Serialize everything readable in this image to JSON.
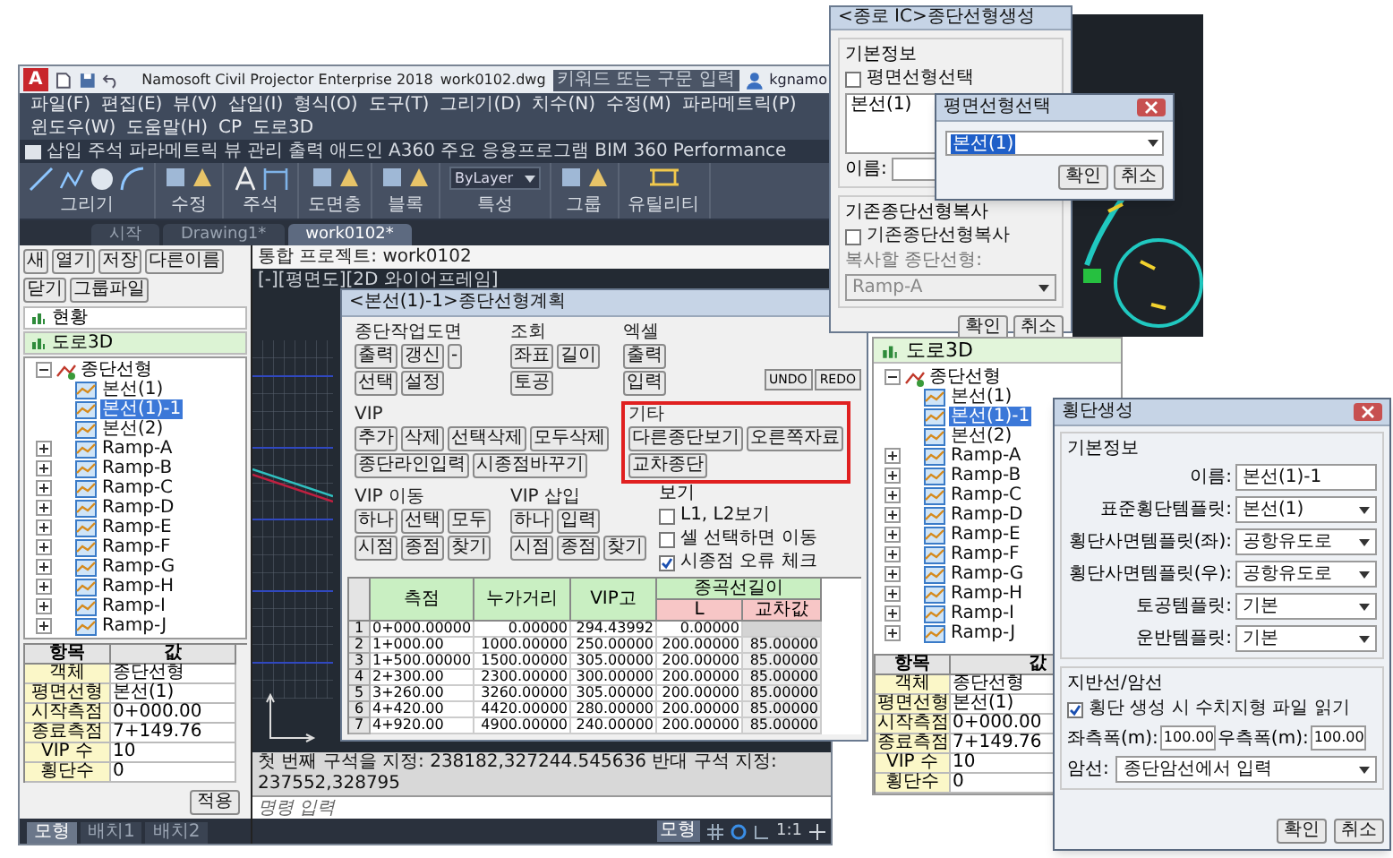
{
  "main_window": {
    "logo": "A",
    "title": "Namosoft Civil Projector Enterprise 2018",
    "file": "work0102.dwg",
    "search": {
      "placeholder": "키워드 또는 구문 입력"
    },
    "user": "kgnamo",
    "menu": [
      "파일(F)",
      "편집(E)",
      "뷰(V)",
      "삽입(I)",
      "형식(O)",
      "도구(T)",
      "그리기(D)",
      "치수(N)",
      "수정(M)",
      "파라메트릭(P)",
      "윈도우(W)",
      "도움말(H)",
      "CP",
      "도로3D"
    ],
    "ribbon_tabs": [
      "삽입",
      "주석",
      "파라메트릭",
      "뷰",
      "관리",
      "출력",
      "애드인",
      "A360",
      "주요 응용프로그램",
      "BIM 360",
      "Performance"
    ],
    "ribbon_panels": [
      {
        "label": "그리기",
        "kind": "draw"
      },
      {
        "label": "수정",
        "kind": "tools"
      },
      {
        "label": "주석",
        "kind": "text"
      },
      {
        "label": "도면층",
        "kind": "tools"
      },
      {
        "label": "블록",
        "kind": "tools"
      },
      {
        "label": "특성",
        "kind": "property",
        "value": "ByLayer"
      },
      {
        "label": "그룹",
        "kind": "tools"
      },
      {
        "label": "유틸리티",
        "kind": "measure"
      }
    ],
    "doc_tabs": [
      {
        "label": "시작",
        "selected": false
      },
      {
        "label": "Drawing1*",
        "selected": false
      },
      {
        "label": "work0102*",
        "selected": true
      }
    ],
    "left_panel": {
      "buttons": [
        "새",
        "열기",
        "저장",
        "다른이름",
        "닫기",
        "그룹파일"
      ],
      "sections": [
        {
          "label": "현황",
          "selected": false
        },
        {
          "label": "도로3D",
          "selected": true
        }
      ],
      "tree": {
        "label": "종단선형",
        "expanded": true,
        "children": [
          {
            "label": "본선(1)",
            "selected": false,
            "expandable": false
          },
          {
            "label": "본선(1)-1",
            "selected": true,
            "expandable": false
          },
          {
            "label": "본선(2)",
            "selected": false,
            "expandable": false
          },
          {
            "label": "Ramp-A",
            "selected": false,
            "expandable": true
          },
          {
            "label": "Ramp-B",
            "selected": false,
            "expandable": true
          },
          {
            "label": "Ramp-C",
            "selected": false,
            "expandable": true
          },
          {
            "label": "Ramp-D",
            "selected": false,
            "expandable": true
          },
          {
            "label": "Ramp-E",
            "selected": false,
            "expandable": true
          },
          {
            "label": "Ramp-F",
            "selected": false,
            "expandable": true
          },
          {
            "label": "Ramp-G",
            "selected": false,
            "expandable": true
          },
          {
            "label": "Ramp-H",
            "selected": false,
            "expandable": true
          },
          {
            "label": "Ramp-I",
            "selected": false,
            "expandable": true
          },
          {
            "label": "Ramp-J",
            "selected": false,
            "expandable": true
          }
        ]
      },
      "properties": {
        "columns": [
          "항목",
          "값"
        ],
        "rows": [
          [
            "객체",
            "종단선형"
          ],
          [
            "평면선형",
            "본선(1)"
          ],
          [
            "시작측점",
            "0+000.00"
          ],
          [
            "종료측점",
            "7+149.76"
          ],
          [
            "VIP 수",
            "10"
          ],
          [
            "횡단수",
            "0"
          ]
        ]
      },
      "apply_button": "적용"
    },
    "layout_tabs": [
      {
        "label": "모형",
        "selected": true
      },
      {
        "label": "배치1",
        "selected": false
      },
      {
        "label": "배치2",
        "selected": false
      }
    ],
    "viewport": {
      "project": "통합 프로젝트: work0102",
      "label": "[-][평면도][2D 와이어프레임]"
    },
    "command": {
      "history": "첫 번째 구석을 지정: 238182,327244.545636 반대 구석 지정: 237552,328795",
      "placeholder": "명령 입력"
    },
    "status_bar": {
      "model": "모형",
      "scale": "1:1"
    }
  },
  "profile_dialog": {
    "title": "<본선(1)-1>종단선형계획",
    "top_groups": [
      {
        "label": "종단작업도면",
        "highlighted": false,
        "rows": [
          {
            "buttons": [
              "출력",
              "갱신",
              "-"
            ]
          },
          {
            "buttons": [
              "선택",
              "설정"
            ]
          }
        ]
      },
      {
        "label": "조회",
        "highlighted": false,
        "rows": [
          {
            "buttons": [
              "좌표",
              "길이"
            ]
          },
          {
            "buttons": [
              "토공"
            ]
          }
        ]
      },
      {
        "label": "엑셀",
        "highlighted": false,
        "rows": [
          {
            "buttons": [
              "출력"
            ]
          },
          {
            "buttons": [
              "입력"
            ]
          }
        ]
      }
    ],
    "undo_redo": [
      "UNDO",
      "REDO"
    ],
    "middle_groups": [
      {
        "label": "VIP",
        "highlighted": false,
        "rows": [
          {
            "buttons": [
              "추가",
              "삭제",
              "선택삭제",
              "모두삭제"
            ]
          },
          {
            "buttons": [
              "종단라인입력",
              "시종점바꾸기"
            ]
          }
        ]
      },
      {
        "label": "기타",
        "highlighted": true,
        "rows": [
          {
            "buttons": [
              "다른종단보기",
              "오른쪽자료"
            ]
          },
          {
            "buttons": [
              "교차종단"
            ]
          }
        ]
      }
    ],
    "bottom_groups": [
      {
        "label": "VIP 이동",
        "highlighted": false,
        "rows": [
          {
            "buttons": [
              "하나",
              "선택",
              "모두"
            ]
          },
          {
            "buttons": [
              "시점",
              "종점",
              "찾기"
            ]
          }
        ]
      },
      {
        "label": "VIP 삽입",
        "highlighted": false,
        "rows": [
          {
            "buttons": [
              "하나",
              "입력"
            ]
          },
          {
            "buttons": [
              "시점",
              "종점",
              "찾기"
            ]
          }
        ]
      }
    ],
    "view_options": {
      "label": "보기",
      "options": [
        {
          "label": "L1, L2보기",
          "checked": false
        },
        {
          "label": "셀 선택하면 이동",
          "checked": false
        },
        {
          "label": "시종점 오류 체크",
          "checked": true
        }
      ]
    },
    "table": {
      "columns": [
        "측점",
        "누가거리",
        "VIP고"
      ],
      "group_header": "종곡선길이",
      "sub_columns": [
        "L",
        "교차값"
      ],
      "rows": [
        {
          "index": "1",
          "cells": [
            "0+000.00000",
            "0.00000",
            "294.43992",
            "0.00000"
          ]
        },
        {
          "index": "2",
          "cells": [
            "1+000.00",
            "1000.00000",
            "250.00000",
            "200.00000",
            "85.00000"
          ]
        },
        {
          "index": "3",
          "cells": [
            "1+500.00000",
            "1500.00000",
            "305.00000",
            "200.00000",
            "85.00000"
          ]
        },
        {
          "index": "4",
          "cells": [
            "2+300.00",
            "2300.00000",
            "300.00000",
            "200.00000",
            "85.00000"
          ]
        },
        {
          "index": "5",
          "cells": [
            "3+260.00",
            "3260.00000",
            "305.00000",
            "200.00000",
            "85.00000"
          ]
        },
        {
          "index": "6",
          "cells": [
            "4+420.00",
            "4420.00000",
            "280.00000",
            "200.00000",
            "85.00000"
          ]
        },
        {
          "index": "7",
          "cells": [
            "4+920.00",
            "4900.00000",
            "240.00000",
            "200.00000",
            "85.00000"
          ]
        }
      ]
    }
  },
  "profile_create_dialog": {
    "title": "<종로 IC>종단선형생성",
    "basic": {
      "label": "기본정보",
      "checkbox": {
        "label": "평면선형선택",
        "checked": false
      },
      "list": [
        "본선(1)"
      ],
      "name_label": "이름:"
    },
    "copy": {
      "label": "기존종단선형복사",
      "checkbox": {
        "label": "기존종단선형복사",
        "checked": false
      },
      "source_label": "복사할 종단선형:",
      "source_value": "Ramp-A",
      "disabled": true
    },
    "buttons": [
      "확인",
      "취소"
    ]
  },
  "select_dialog": {
    "title": "평면선형선택",
    "value": "본선(1)",
    "buttons": [
      "확인",
      "취소"
    ]
  },
  "right_panel": {
    "header": "도로3D",
    "tree": {
      "label": "종단선형",
      "expanded": true,
      "children": [
        {
          "label": "본선(1)",
          "selected": false,
          "expandable": false
        },
        {
          "label": "본선(1)-1",
          "selected": true,
          "expandable": false
        },
        {
          "label": "본선(2)",
          "selected": false,
          "expandable": false
        },
        {
          "label": "Ramp-A",
          "selected": false,
          "expandable": true
        },
        {
          "label": "Ramp-B",
          "selected": false,
          "expandable": true
        },
        {
          "label": "Ramp-C",
          "selected": false,
          "expandable": true
        },
        {
          "label": "Ramp-D",
          "selected": false,
          "expandable": true
        },
        {
          "label": "Ramp-E",
          "selected": false,
          "expandable": true
        },
        {
          "label": "Ramp-F",
          "selected": false,
          "expandable": true
        },
        {
          "label": "Ramp-G",
          "selected": false,
          "expandable": true
        },
        {
          "label": "Ramp-H",
          "selected": false,
          "expandable": true
        },
        {
          "label": "Ramp-I",
          "selected": false,
          "expandable": true
        },
        {
          "label": "Ramp-J",
          "selected": false,
          "expandable": true
        }
      ]
    },
    "properties": {
      "columns": [
        "항목",
        "값"
      ],
      "rows": [
        [
          "객체",
          "종단선형"
        ],
        [
          "평면선형",
          "본선(1)"
        ],
        [
          "시작측점",
          "0+000.00"
        ],
        [
          "종료측점",
          "7+149.76"
        ],
        [
          "VIP 수",
          "10"
        ],
        [
          "횡단수",
          "0"
        ]
      ]
    }
  },
  "cross_dialog": {
    "title": "횡단생성",
    "basic": {
      "label": "기본정보",
      "fields": [
        {
          "label": "이름:",
          "value": "본선(1)-1",
          "kind": "text"
        },
        {
          "label": "표준횡단템플릿:",
          "value": "본선(1)",
          "kind": "select"
        },
        {
          "label": "횡단사면템플릿(좌):",
          "value": "공항유도로",
          "kind": "select"
        },
        {
          "label": "횡단사면템플릿(우):",
          "value": "공항유도로",
          "kind": "select"
        },
        {
          "label": "토공템플릿:",
          "value": "기본",
          "kind": "select"
        },
        {
          "label": "운반템플릿:",
          "value": "기본",
          "kind": "select"
        }
      ]
    },
    "ground": {
      "label": "지반선/암선",
      "checkbox": {
        "label": "횡단 생성 시 수치지형 파일 읽기",
        "checked": true
      },
      "widths": [
        {
          "label": "좌측폭(m):",
          "value": "100.00"
        },
        {
          "label": "우측폭(m):",
          "value": "100.00"
        }
      ],
      "rock": {
        "label": "암선:",
        "value": "종단암선에서 입력"
      }
    },
    "buttons": [
      "확인",
      "취소"
    ]
  }
}
